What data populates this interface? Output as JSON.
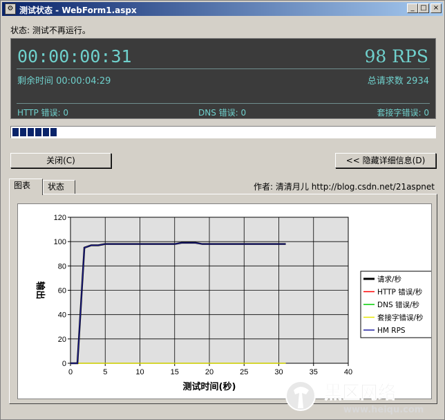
{
  "window": {
    "icon": "app-icon",
    "title": "测试状态 - WebForm1.aspx",
    "min_label": "_",
    "max_label": "□",
    "close_label": "×"
  },
  "status": {
    "line": "状态: 测试不再运行。"
  },
  "panel": {
    "elapsed": "00:00:00:31",
    "rps": "98 RPS",
    "remaining": "剩余时间 00:00:04:29",
    "total": "总请求数 2934",
    "http_errors": "HTTP 错误: 0",
    "dns_errors": "DNS 错误: 0",
    "socket_errors": "套接字错误: 0",
    "text_color": "#6fd0cc",
    "bg_color": "#3b3b3b"
  },
  "progress": {
    "segments": 6
  },
  "buttons": {
    "close": "关闭(C)",
    "hide_details": "<< 隐藏详细信息(D)"
  },
  "tabs": [
    {
      "label": "图表",
      "active": true
    },
    {
      "label": "状态",
      "active": false
    }
  ],
  "author": "作者: 清清月儿 http://blog.csdn.net/21aspnet",
  "watermark": {
    "text": "黑区网络",
    "url": "www.heiqu.com"
  },
  "chart_data": {
    "type": "line",
    "xlabel": "测试时间(秒)",
    "ylabel": "输出",
    "xlim": [
      0,
      40
    ],
    "ylim": [
      0,
      120
    ],
    "xticks": [
      0,
      5,
      10,
      15,
      20,
      25,
      30,
      35,
      40
    ],
    "yticks": [
      0,
      20,
      40,
      60,
      80,
      100,
      120
    ],
    "grid": true,
    "legend_position": "right",
    "series": [
      {
        "name": "请求/秒",
        "color": "#000000",
        "x": [
          0,
          1,
          2,
          3,
          4,
          5,
          6,
          7,
          8,
          9,
          10,
          11,
          12,
          13,
          14,
          15,
          16,
          17,
          18,
          19,
          20,
          21,
          22,
          23,
          24,
          25,
          26,
          27,
          28,
          29,
          30,
          31
        ],
        "y": [
          0,
          0,
          95,
          97,
          97,
          98,
          98,
          98,
          98,
          98,
          98,
          98,
          98,
          98,
          98,
          98,
          99,
          99,
          99,
          98,
          98,
          98,
          98,
          98,
          98,
          98,
          98,
          98,
          98,
          98,
          98,
          98
        ]
      },
      {
        "name": "HTTP 错误/秒",
        "color": "#ff0000",
        "x": [
          0,
          31
        ],
        "y": [
          0,
          0
        ]
      },
      {
        "name": "DNS 错误/秒",
        "color": "#00cc00",
        "x": [
          0,
          31
        ],
        "y": [
          0,
          0
        ]
      },
      {
        "name": "套接字错误/秒",
        "color": "#e6e600",
        "x": [
          0,
          31
        ],
        "y": [
          0,
          0
        ]
      },
      {
        "name": "HM RPS",
        "color": "#2020a0",
        "x": [
          0,
          1,
          2,
          3,
          4,
          5,
          6,
          7,
          8,
          9,
          10,
          11,
          12,
          13,
          14,
          15,
          16,
          17,
          18,
          19,
          20,
          21,
          22,
          23,
          24,
          25,
          26,
          27,
          28,
          29,
          30,
          31
        ],
        "y": [
          0,
          0,
          95,
          97,
          97,
          98,
          98,
          98,
          98,
          98,
          98,
          98,
          98,
          98,
          98,
          98,
          99,
          99,
          99,
          98,
          98,
          98,
          98,
          98,
          98,
          98,
          98,
          98,
          98,
          98,
          98,
          98
        ]
      }
    ]
  }
}
